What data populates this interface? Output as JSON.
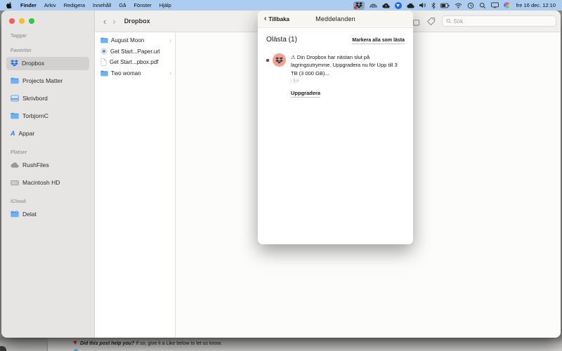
{
  "menubar": {
    "menus": [
      "Finder",
      "Arkiv",
      "Redigera",
      "Innehåll",
      "Gå",
      "Fönster",
      "Hjälp"
    ],
    "status_icons": [
      "dropbox",
      "signal-arcs",
      "cloud-alert",
      "shield",
      "cloud",
      "volume",
      "bluetooth",
      "battery",
      "wifi",
      "history",
      "spotlight",
      "display",
      "color-wheel"
    ],
    "clock": "fre 16 dec. 12:10"
  },
  "window": {
    "toolbar": {
      "back": "‹",
      "forward": "›",
      "title": "Dropbox",
      "search_placeholder": "Sök"
    },
    "sidebar": {
      "sections": [
        {
          "label": "Taggar",
          "items": []
        },
        {
          "label": "Favoriter",
          "items": [
            {
              "label": "Dropbox",
              "icon": "dropbox-icon",
              "selected": true
            },
            {
              "label": "Projects Matter",
              "icon": "folder-icon"
            },
            {
              "label": "Skrivbord",
              "icon": "desktop-icon"
            },
            {
              "label": "TorbjornC",
              "icon": "folder-icon"
            },
            {
              "label": "Appar",
              "icon": "apps-icon"
            }
          ]
        },
        {
          "label": "Platser",
          "items": [
            {
              "label": "RushFiles",
              "icon": "cloud-icon"
            },
            {
              "label": "Macintosh HD",
              "icon": "harddrive-icon"
            }
          ]
        },
        {
          "label": "iCloud",
          "items": [
            {
              "label": "Delat",
              "icon": "shared-folder-icon"
            }
          ]
        }
      ]
    },
    "files": [
      {
        "name": "August Moon",
        "type": "folder",
        "chevron": "›"
      },
      {
        "name": "Get Start...Paper.url",
        "type": "url-file",
        "chevron": ""
      },
      {
        "name": "Get Start...pbox.pdf",
        "type": "pdf-file",
        "chevron": ""
      },
      {
        "name": "Two woman",
        "type": "folder",
        "chevron": "›"
      }
    ]
  },
  "panel": {
    "back_label": "Tillbaka",
    "back_chevron": "‹",
    "title": "Meddelanden",
    "unread_label": "Olästa (1)",
    "mark_all_label": "Markera alla som lästa",
    "notification": {
      "text": "⚠ Din Dropbox har nästan slut på lagringsutrymme. Uppgradera nu för Upp till 3 TB (3 000 GB)...",
      "time": "i fjol",
      "action_label": "Uppgradera"
    }
  },
  "background_window": {
    "heart": "♥",
    "line_bold": "Did this post help you?",
    "line_rest": " If so, give it a Like below to let us know."
  },
  "colors": {
    "menubar_bg": "#adcdf0",
    "dropbox_blue": "#1d6ff2",
    "avatar_salmon": "#f2a28c",
    "unread_red": "#a3241f",
    "sidebar_bg": "#e6e5e3"
  }
}
